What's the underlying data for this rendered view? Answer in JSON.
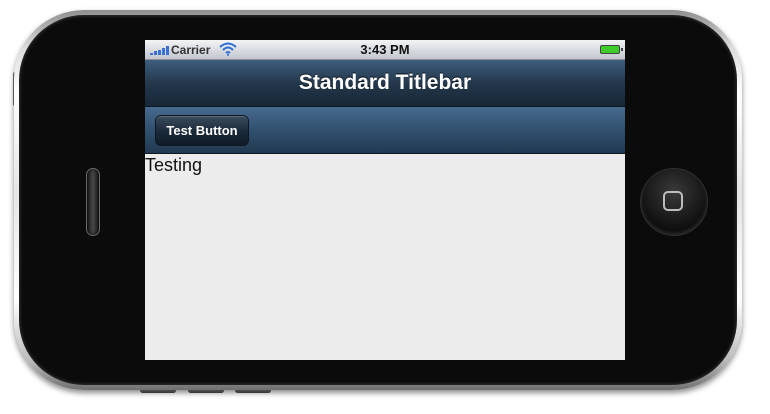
{
  "status_bar": {
    "carrier": "Carrier",
    "time": "3:43 PM",
    "icons": [
      "signal-icon",
      "wifi-icon",
      "battery-icon"
    ]
  },
  "titlebar": {
    "title": "Standard Titlebar"
  },
  "toolbar": {
    "button_label": "Test Button"
  },
  "content": {
    "text": "Testing"
  },
  "colors": {
    "titlebar": "#24384c",
    "toolbar": "#2f4e6d",
    "button": "#1a2938",
    "content_bg": "#ececec",
    "battery": "#3fcc2a"
  }
}
